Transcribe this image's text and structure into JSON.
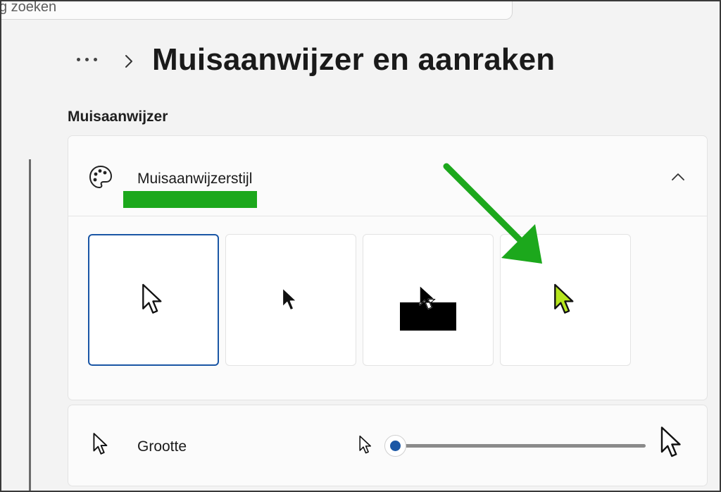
{
  "search": {
    "partial_text": "g zoeken"
  },
  "header": {
    "title": "Muisaanwijzer en aanraken"
  },
  "section": {
    "label": "Muisaanwijzer"
  },
  "pointer_style": {
    "label": "Muisaanwijzerstijl",
    "options": [
      {
        "name": "white",
        "selected": true
      },
      {
        "name": "black",
        "selected": false
      },
      {
        "name": "inverted",
        "selected": false
      },
      {
        "name": "custom-color",
        "selected": false
      }
    ],
    "custom_color": "#b6e61e"
  },
  "size": {
    "label": "Grootte",
    "slider_value_fraction": 0.0
  },
  "colors": {
    "accent": "#1a56a5",
    "annotation_green": "#1ca81c"
  },
  "icons": [
    "more-icon",
    "chevron-right-icon",
    "palette-icon",
    "chevron-up-icon",
    "cursor-icon"
  ]
}
